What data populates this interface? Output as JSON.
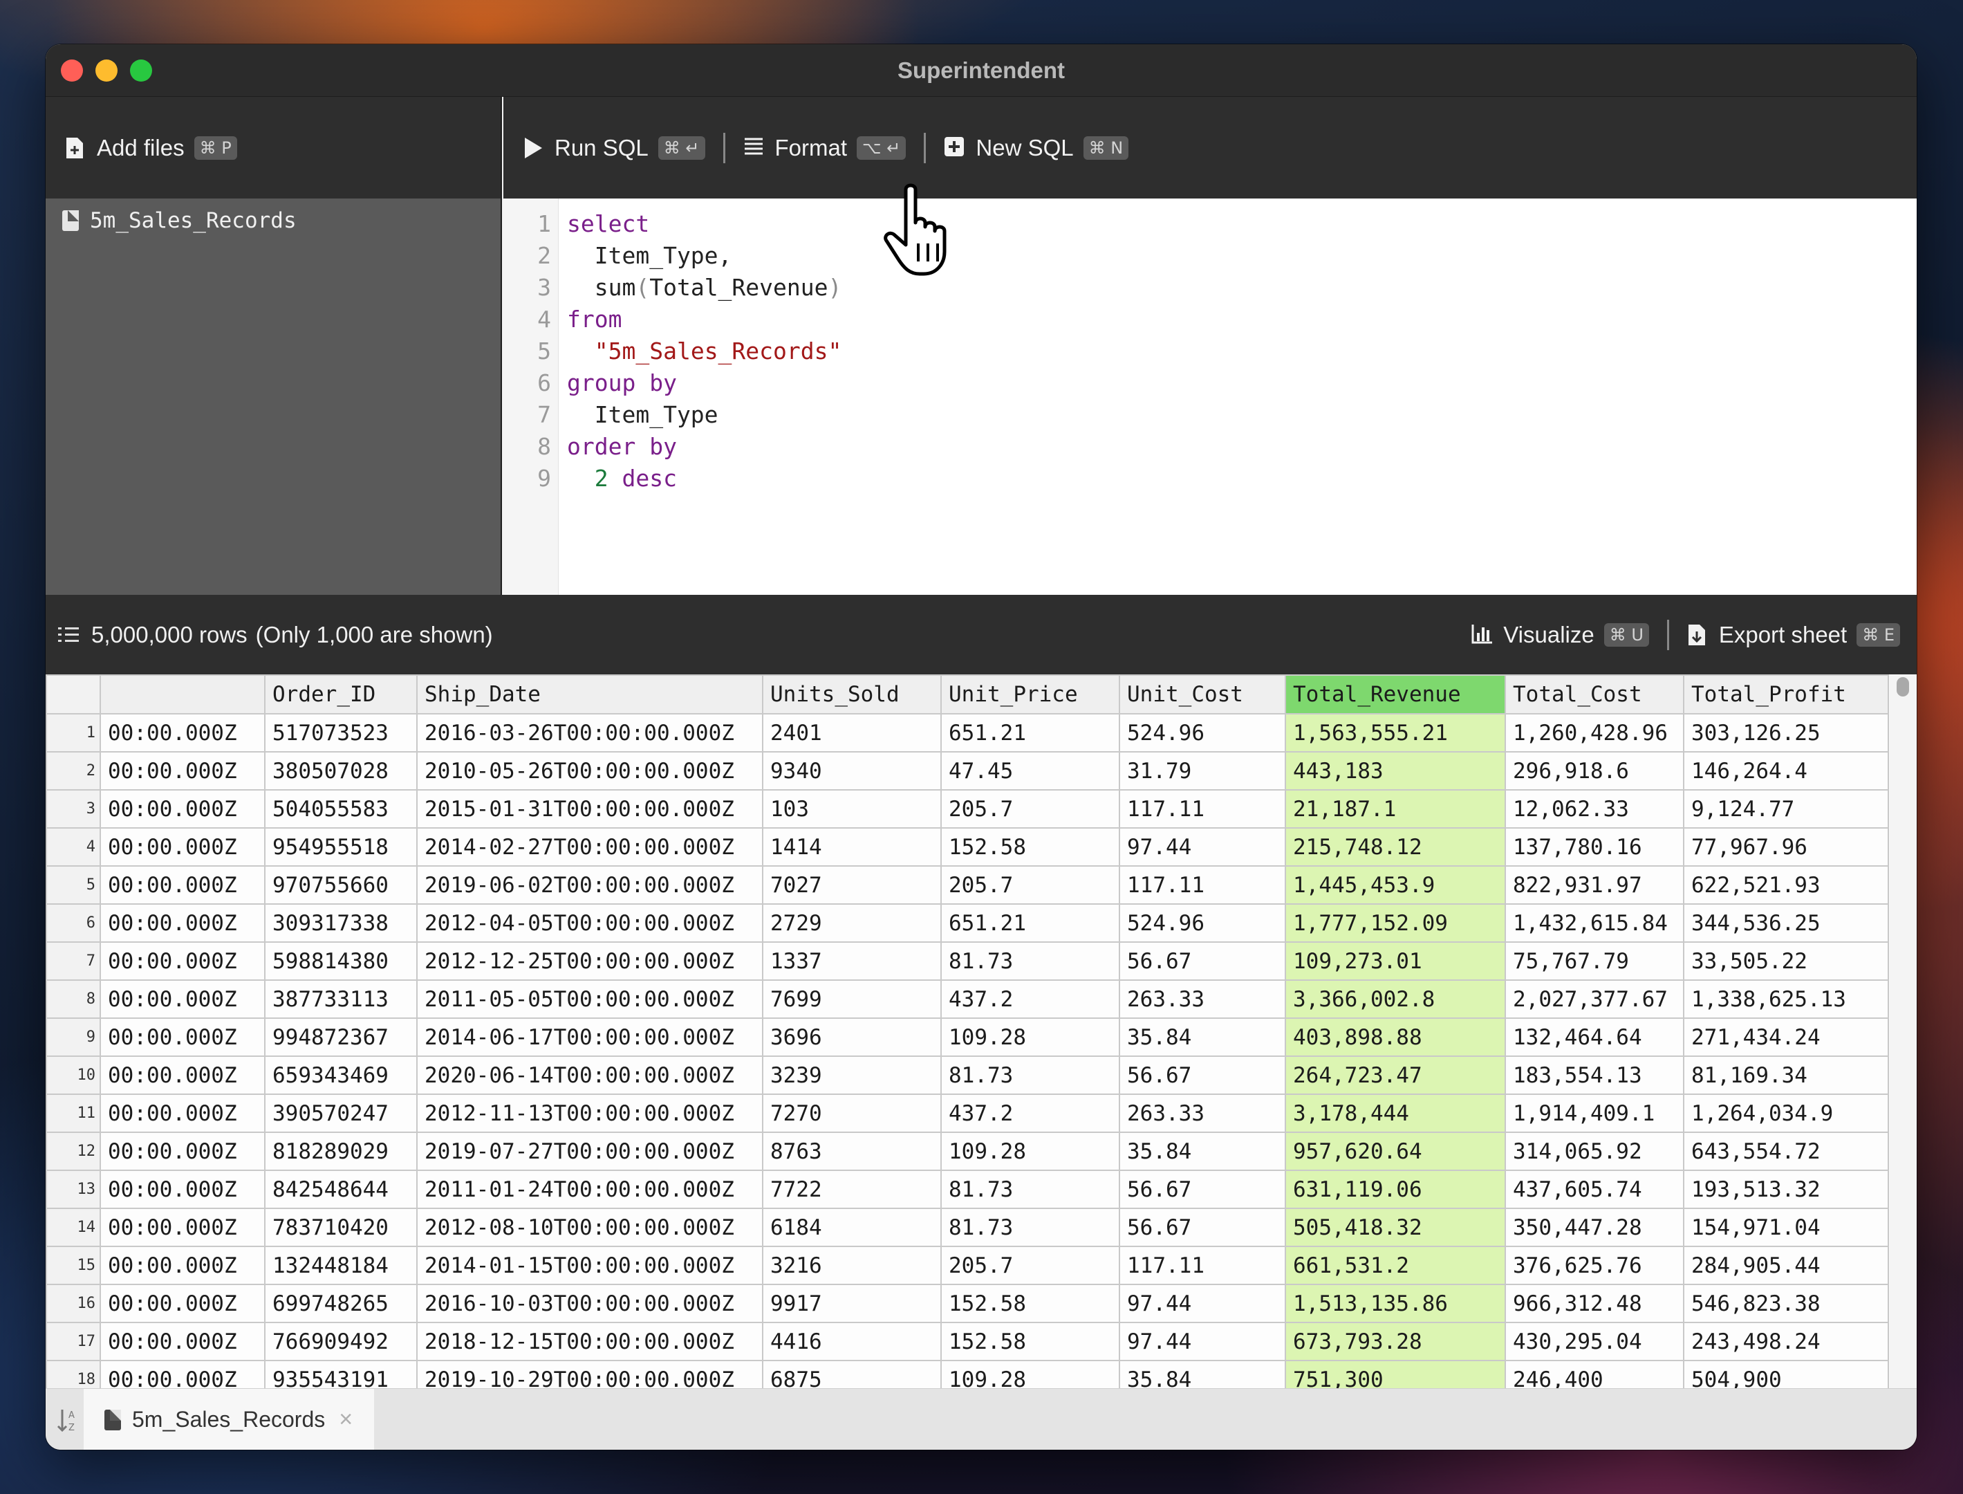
{
  "window": {
    "title": "Superintendent"
  },
  "toolbar": {
    "add_files": {
      "label": "Add files",
      "shortcut": "⌘ P"
    },
    "run_sql": {
      "label": "Run SQL",
      "shortcut": "⌘ ↵"
    },
    "format": {
      "label": "Format",
      "shortcut": "⌥ ↵"
    },
    "new_sql": {
      "label": "New SQL",
      "shortcut": "⌘ N"
    }
  },
  "sidebar": {
    "files": [
      {
        "name": "5m_Sales_Records",
        "type": "csv"
      }
    ]
  },
  "editor": {
    "line_numbers": [
      "1",
      "2",
      "3",
      "4",
      "5",
      "6",
      "7",
      "8",
      "9"
    ]
  },
  "status": {
    "rows_text": "5,000,000 rows",
    "shown_text": "(Only 1,000 are shown)",
    "visualize": {
      "label": "Visualize",
      "shortcut": "⌘ U"
    },
    "export": {
      "label": "Export sheet",
      "shortcut": "⌘ E"
    }
  },
  "grid": {
    "highlight_color": "#7ed86e",
    "highlight_cell_color": "#dcf5b2",
    "columns": [
      "",
      "Order_ID",
      "Ship_Date",
      "Units_Sold",
      "Unit_Price",
      "Unit_Cost",
      "Total_Revenue",
      "Total_Cost",
      "Total_Profit"
    ],
    "highlighted_column": "Total_Revenue",
    "rows": [
      [
        "00:00.000Z",
        "517073523",
        "2016-03-26T00:00:00.000Z",
        "2401",
        "651.21",
        "524.96",
        "1,563,555.21",
        "1,260,428.96",
        "303,126.25"
      ],
      [
        "00:00.000Z",
        "380507028",
        "2010-05-26T00:00:00.000Z",
        "9340",
        "47.45",
        "31.79",
        "443,183",
        "296,918.6",
        "146,264.4"
      ],
      [
        "00:00.000Z",
        "504055583",
        "2015-01-31T00:00:00.000Z",
        "103",
        "205.7",
        "117.11",
        "21,187.1",
        "12,062.33",
        "9,124.77"
      ],
      [
        "00:00.000Z",
        "954955518",
        "2014-02-27T00:00:00.000Z",
        "1414",
        "152.58",
        "97.44",
        "215,748.12",
        "137,780.16",
        "77,967.96"
      ],
      [
        "00:00.000Z",
        "970755660",
        "2019-06-02T00:00:00.000Z",
        "7027",
        "205.7",
        "117.11",
        "1,445,453.9",
        "822,931.97",
        "622,521.93"
      ],
      [
        "00:00.000Z",
        "309317338",
        "2012-04-05T00:00:00.000Z",
        "2729",
        "651.21",
        "524.96",
        "1,777,152.09",
        "1,432,615.84",
        "344,536.25"
      ],
      [
        "00:00.000Z",
        "598814380",
        "2012-12-25T00:00:00.000Z",
        "1337",
        "81.73",
        "56.67",
        "109,273.01",
        "75,767.79",
        "33,505.22"
      ],
      [
        "00:00.000Z",
        "387733113",
        "2011-05-05T00:00:00.000Z",
        "7699",
        "437.2",
        "263.33",
        "3,366,002.8",
        "2,027,377.67",
        "1,338,625.13"
      ],
      [
        "00:00.000Z",
        "994872367",
        "2014-06-17T00:00:00.000Z",
        "3696",
        "109.28",
        "35.84",
        "403,898.88",
        "132,464.64",
        "271,434.24"
      ],
      [
        "00:00.000Z",
        "659343469",
        "2020-06-14T00:00:00.000Z",
        "3239",
        "81.73",
        "56.67",
        "264,723.47",
        "183,554.13",
        "81,169.34"
      ],
      [
        "00:00.000Z",
        "390570247",
        "2012-11-13T00:00:00.000Z",
        "7270",
        "437.2",
        "263.33",
        "3,178,444",
        "1,914,409.1",
        "1,264,034.9"
      ],
      [
        "00:00.000Z",
        "818289029",
        "2019-07-27T00:00:00.000Z",
        "8763",
        "109.28",
        "35.84",
        "957,620.64",
        "314,065.92",
        "643,554.72"
      ],
      [
        "00:00.000Z",
        "842548644",
        "2011-01-24T00:00:00.000Z",
        "7722",
        "81.73",
        "56.67",
        "631,119.06",
        "437,605.74",
        "193,513.32"
      ],
      [
        "00:00.000Z",
        "783710420",
        "2012-08-10T00:00:00.000Z",
        "6184",
        "81.73",
        "56.67",
        "505,418.32",
        "350,447.28",
        "154,971.04"
      ],
      [
        "00:00.000Z",
        "132448184",
        "2014-01-15T00:00:00.000Z",
        "3216",
        "205.7",
        "117.11",
        "661,531.2",
        "376,625.76",
        "284,905.44"
      ],
      [
        "00:00.000Z",
        "699748265",
        "2016-10-03T00:00:00.000Z",
        "9917",
        "152.58",
        "97.44",
        "1,513,135.86",
        "966,312.48",
        "546,823.38"
      ],
      [
        "00:00.000Z",
        "766909492",
        "2018-12-15T00:00:00.000Z",
        "4416",
        "152.58",
        "97.44",
        "673,793.28",
        "430,295.04",
        "243,498.24"
      ],
      [
        "00:00.000Z",
        "935543191",
        "2019-10-29T00:00:00.000Z",
        "6875",
        "109.28",
        "35.84",
        "751,300",
        "246,400",
        "504,900"
      ]
    ]
  },
  "bottom_tabs": [
    {
      "label": "5m_Sales_Records",
      "close": "×"
    }
  ],
  "icons": {
    "add_files": "file-plus-icon",
    "run": "play-icon",
    "format": "align-justify-icon",
    "new_sql": "plus-square-icon",
    "rows": "list-icon",
    "visualize": "bar-chart-icon",
    "export": "file-export-icon",
    "sort": "sort-icon",
    "cursor": "hand-pointer-icon"
  }
}
